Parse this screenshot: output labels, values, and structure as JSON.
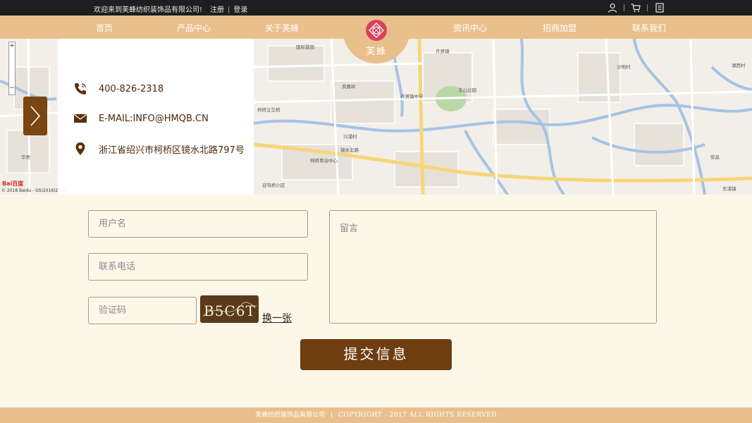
{
  "topbar": {
    "welcome": "欢迎来到芙蜂纺织装饰品有限公司!",
    "register": "注册",
    "separator": "|",
    "login": "登录",
    "icons": [
      "user-icon",
      "cart-icon",
      "notebook-icon"
    ]
  },
  "nav": {
    "items": [
      "首页",
      "产品中心",
      "关于芙蜂",
      "资讯中心",
      "招商加盟",
      "联系我们"
    ],
    "active": "联系我们",
    "logo_text": "芙蜂"
  },
  "contact": {
    "phone": "400-826-2318",
    "email": "E-MAIL:INFO@HMQB.CN",
    "address": "浙江省绍兴市柯桥区镜水北路797号"
  },
  "map": {
    "labels": [
      "国际鼎园",
      "华舍",
      "齐贤镇",
      "柯桥立交桥",
      "镜水北路",
      "兴浦村",
      "迎驾桥小区",
      "柯桥育溢中心",
      "湖西村",
      "沙地村",
      "东浦镇",
      "安昌",
      "齐贤镇中学",
      "羊山公园",
      "凤凰岭"
    ],
    "credit": "© 2018 Baidu - GS(2016)2089",
    "baidu_logo": "Bai百度",
    "zoom_plus": "+",
    "zoom_minus": "−"
  },
  "form": {
    "username_placeholder": "用户名",
    "phone_placeholder": "联系电话",
    "captcha_placeholder": "验证码",
    "message_placeholder": "留言",
    "captcha_code": "B5C6T",
    "refresh_label": "换一张",
    "submit_label": "提交信息"
  },
  "footer": {
    "company": "芙蜂纺织装饰品有限公司",
    "separator": "|",
    "copyright": "COPYRIGHT - 2017 ALL RIGHTS RESERVED"
  },
  "colors": {
    "nav_bg": "#e9c08c",
    "topbar_bg": "#1e1e1e",
    "page_bg": "#fdf7ea",
    "button_brown": "#6e3d10",
    "logo_red": "#d8425b"
  }
}
